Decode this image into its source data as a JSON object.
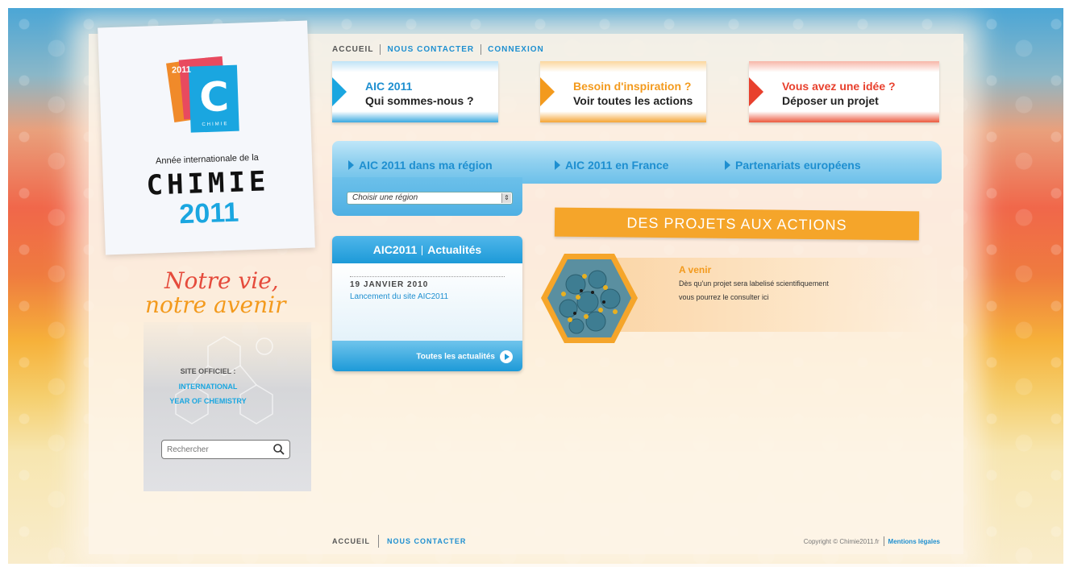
{
  "top_nav": {
    "home": "ACCUEIL",
    "contact": "NOUS CONTACTER",
    "login": "CONNEXION"
  },
  "header_buttons": [
    {
      "line1": "AIC 2011",
      "line2": "Qui sommes-nous ?"
    },
    {
      "line1": "Besoin d'inspiration ?",
      "line2": "Voir toutes les actions"
    },
    {
      "line1": "Vous avez une idée ?",
      "line2": "Déposer un projet"
    }
  ],
  "logo": {
    "year_small": "2011",
    "letter": "C",
    "word": "CHIMIE",
    "annee": "Année internationale de la",
    "title": "CHIMIE",
    "year": "2011"
  },
  "slogan": {
    "line1": "Notre vie,",
    "line2": "notre avenir"
  },
  "sidebar": {
    "official": "SITE OFFICIEL :",
    "iyc_line1": "INTERNATIONAL",
    "iyc_line2": "YEAR OF CHEMISTRY",
    "search_placeholder": "Rechercher"
  },
  "region_bar": {
    "links": [
      "AIC 2011 dans ma région",
      "AIC 2011 en France",
      "Partenariats européens"
    ],
    "select_value": "Choisir une région"
  },
  "news": {
    "title_a": "AIC2011",
    "title_b": "Actualités",
    "date": "19 JANVIER 2010",
    "headline": "Lancement du site AIC2011",
    "all_news": "Toutes les actualités"
  },
  "projects": {
    "banner": "DES PROJETS AUX ACTIONS",
    "title": "A venir",
    "text": "Dès qu'un projet sera labelisé scientifiquement vous pourrez le consulter ici"
  },
  "footer": {
    "home": "ACCUEIL",
    "contact": "NOUS CONTACTER",
    "copyright": "Copyright © Chimie2011.fr",
    "legal": "Mentions légales"
  },
  "colors": {
    "blue": "#1e8fd0",
    "orange": "#f39a1d",
    "red": "#e8402d"
  }
}
